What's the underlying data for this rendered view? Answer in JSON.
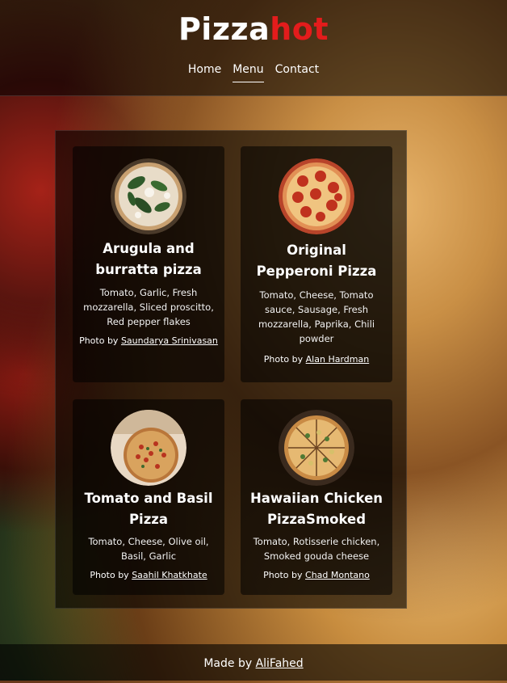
{
  "header": {
    "logo_part1": "Pizza",
    "logo_part2": "hot",
    "nav": [
      {
        "label": "Home",
        "active": false
      },
      {
        "label": "Menu",
        "active": true
      },
      {
        "label": "Contact",
        "active": false
      }
    ]
  },
  "menu": {
    "items": [
      {
        "name": "Arugula and burratta pizza",
        "ingredients": "Tomato, Garlic, Fresh mozzarella, Sliced proscitto, Red pepper flakes",
        "credit_prefix": "Photo by",
        "photographer": "Saundarya Srinivasan"
      },
      {
        "name": "Original Pepperoni Pizza",
        "ingredients": "Tomato, Cheese, Tomato sauce, Sausage, Fresh mozzarella, Paprika, Chili powder",
        "credit_prefix": "Photo by",
        "photographer": "Alan Hardman"
      },
      {
        "name": "Tomato and Basil Pizza",
        "ingredients": "Tomato, Cheese, Olive oil, Basil, Garlic",
        "credit_prefix": "Photo by",
        "photographer": "Saahil Khatkhate"
      },
      {
        "name": "Hawaiian Chicken PizzaSmoked",
        "ingredients": "Tomato, Rotisserie chicken, Smoked gouda cheese",
        "credit_prefix": "Photo by",
        "photographer": "Chad Montano"
      }
    ]
  },
  "footer": {
    "prefix": "Made by",
    "author": "AliFahed"
  },
  "colors": {
    "accent_red": "#e31c1c",
    "text": "#ffffff"
  }
}
